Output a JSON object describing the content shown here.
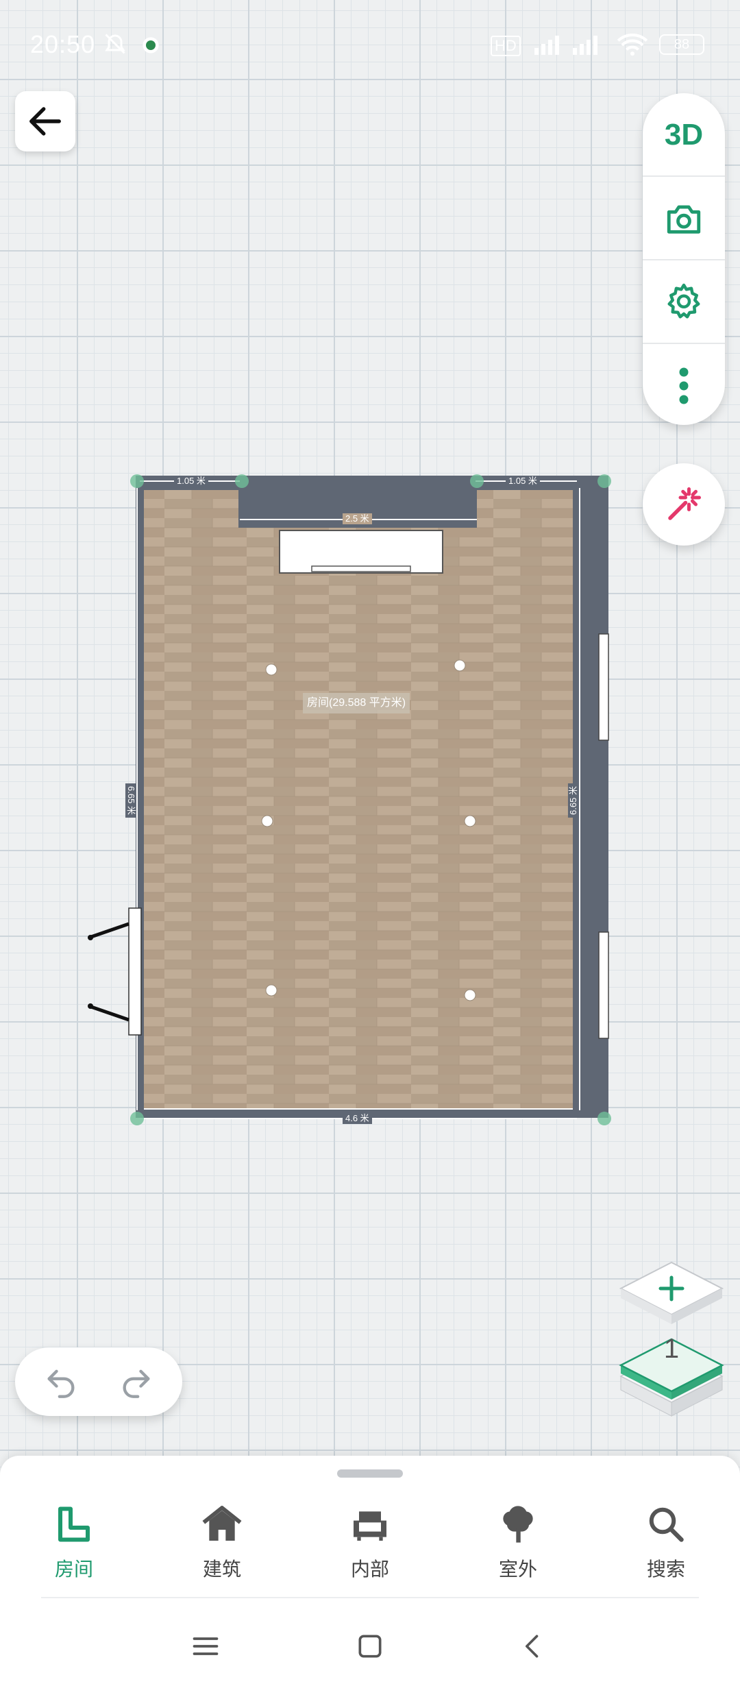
{
  "status_bar": {
    "time": "20:50",
    "network_badge": "HD",
    "battery": "88"
  },
  "toolbar": {
    "view_3d_label": "3D",
    "icons": [
      "camera-icon",
      "gear-icon",
      "more-vertical-icon"
    ]
  },
  "floor_plan": {
    "room_label": "房间(29.588 平方米)",
    "dimensions": {
      "top_left": "1.05 米",
      "top_right": "1.05 米",
      "niche": "2.5 米",
      "left": "6.65 米",
      "right": "6.65 米",
      "bottom": "4.6 米"
    },
    "colors": {
      "wall": "#5f6774",
      "floor": "#b8a48e",
      "accent": "#1f9a6e",
      "magic": "#e4386b"
    }
  },
  "levels": {
    "current_level": "1"
  },
  "bottom_tabs": [
    {
      "label": "房间",
      "icon": "room-icon",
      "active": true
    },
    {
      "label": "建筑",
      "icon": "house-icon",
      "active": false
    },
    {
      "label": "内部",
      "icon": "armchair-icon",
      "active": false
    },
    {
      "label": "室外",
      "icon": "tree-icon",
      "active": false
    },
    {
      "label": "搜索",
      "icon": "search-icon",
      "active": false
    }
  ]
}
